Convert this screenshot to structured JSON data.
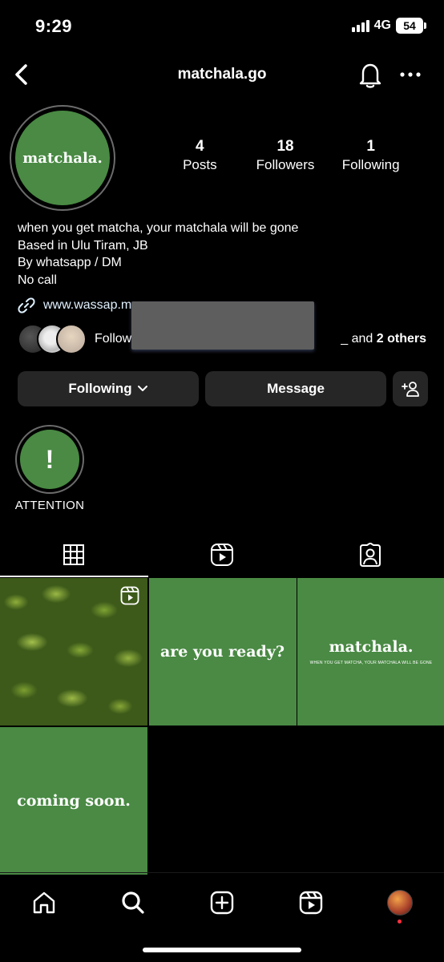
{
  "status_bar": {
    "time": "9:29",
    "network": "4G",
    "battery": "54"
  },
  "header": {
    "username": "matchala.go",
    "back_icon": "chevron-left-icon",
    "bell_icon": "bell-icon",
    "more_icon": "more-horizontal-icon"
  },
  "profile": {
    "avatar_text": "matchala.",
    "stats": [
      {
        "value": "4",
        "label": "Posts"
      },
      {
        "value": "18",
        "label": "Followers"
      },
      {
        "value": "1",
        "label": "Following"
      }
    ],
    "bio": [
      "when you get matcha, your matchala will be gone",
      "Based in Ulu Tiram, JB",
      "By whatsapp / DM",
      "No call"
    ],
    "link": "www.wassap.m",
    "followed_by_prefix": "Follow",
    "followed_by_suffix_sep": "_ and ",
    "followed_by_others": "2 others"
  },
  "actions": {
    "following_label": "Following",
    "message_label": "Message",
    "add_person_icon": "add-person-icon"
  },
  "highlights": [
    {
      "symbol": "!",
      "label": "ATTENTION"
    }
  ],
  "tabs": [
    {
      "icon": "grid-icon",
      "active": true
    },
    {
      "icon": "reels-icon",
      "active": false
    },
    {
      "icon": "tagged-icon",
      "active": false
    }
  ],
  "posts": {
    "p2_text": "are you ready?",
    "p3_brand": "matchala.",
    "p3_tagline": "WHEN YOU GET MATCHA, YOUR MATCHALA WILL BE GONE",
    "p4_text": "coming soon."
  },
  "colors": {
    "brand_green": "#4a8a44",
    "background": "#000000",
    "button_bg": "#262626"
  },
  "bottom_nav": [
    "home-icon",
    "search-icon",
    "create-icon",
    "reels-icon",
    "profile-avatar"
  ]
}
